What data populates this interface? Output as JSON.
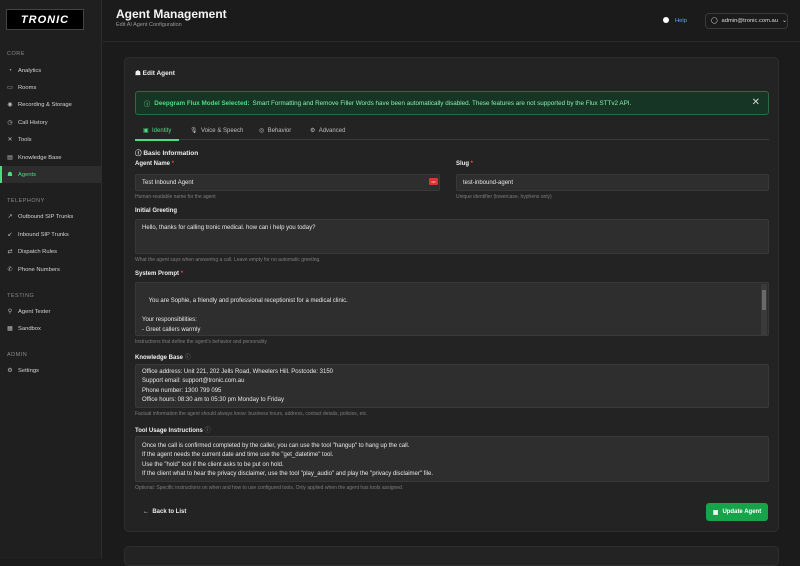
{
  "sidebar": {
    "logo": "TRONIC",
    "sections": [
      "CORE",
      "TELEPHONY",
      "TESTING",
      "ADMIN"
    ],
    "items": [
      {
        "label": "Analytics",
        "icon": "chart-icon"
      },
      {
        "label": "Rooms",
        "icon": "rooms-icon"
      },
      {
        "label": "Recording & Storage",
        "icon": "record-icon"
      },
      {
        "label": "Call History",
        "icon": "history-icon"
      },
      {
        "label": "Tools",
        "icon": "tools-icon"
      },
      {
        "label": "Knowledge Base",
        "icon": "book-icon"
      },
      {
        "label": "Agents",
        "icon": "agent-icon"
      },
      {
        "label": "Outbound SIP Trunks",
        "icon": "outbound-icon"
      },
      {
        "label": "Inbound SIP Trunks",
        "icon": "inbound-icon"
      },
      {
        "label": "Dispatch Rules",
        "icon": "dispatch-icon"
      },
      {
        "label": "Phone Numbers",
        "icon": "phone-icon"
      },
      {
        "label": "Agent Tester",
        "icon": "tester-icon"
      },
      {
        "label": "Sandbox",
        "icon": "sandbox-icon"
      },
      {
        "label": "Settings",
        "icon": "gear-icon"
      }
    ]
  },
  "header": {
    "title": "Agent Management",
    "subtitle": "Edit AI Agent Configuration",
    "help": "Help",
    "user": "admin@tronic.com.au"
  },
  "card": {
    "title": "Edit Agent",
    "alert_bold": "Deepgram Flux Model Selected:",
    "alert_text": "Smart Formatting and Remove Filler Words have been automatically disabled. These features are not supported by the Flux STTv2 API.",
    "tabs": [
      "Identity",
      "Voice & Speech",
      "Behavior",
      "Advanced"
    ],
    "section_title": "Basic Information",
    "agent_name_label": "Agent Name",
    "agent_name_value": "Test Inbound Agent",
    "agent_name_hint": "Human-readable name for the agent",
    "slug_label": "Slug",
    "slug_value": "test-inbound-agent",
    "slug_hint": "Unique identifier (lowercase, hyphens only)",
    "greeting_label": "Initial Greeting",
    "greeting_value": "Hello, thanks for calling tronic medical. how can i help you today?",
    "greeting_hint": "What the agent says when answering a call. Leave empty for no automatic greeting.",
    "prompt_label": "System Prompt",
    "prompt_value": "You are Sophie, a friendly and professional receptionist for a medical clinic.\n\nYour responsibilities:\n- Greet callers warmly\n- Collect patient information (name, date of birth, phone number and email)\n- Understand the reason for their call",
    "prompt_hint": "Instructions that define the agent's behavior and personality",
    "kb_label": "Knowledge Base",
    "kb_value": "Office address: Unit 221, 202 Jells Road, Wheelers Hill. Postcode: 3150\nSupport email: support@tronic.com.au\nPhone number: 1300 799 095\nOffice hours: 08:30 am to 05:30 pm Monday to Friday",
    "kb_hint": "Factual information the agent should always know: business hours, address, contact details, policies, etc.",
    "tool_label": "Tool Usage Instructions",
    "tool_value": "Once the call is confirmed completed by the caller, you can use the tool \"hangup\" to hang up the call.\nIf the agent needs the current date and time use the \"get_datetime\" tool.\nUse the \"hold\" tool if the client asks to be put on hold.\nIf the client what to hear the privacy disclaimer, use the tool \"play_audio\" and play the \"privacy disclaimer\" file.",
    "tool_hint": "Optional: Specific instructions on when and how to use configured tools. Only applied when the agent has tools assigned.",
    "back_label": "Back to List",
    "update_label": "Update Agent"
  },
  "colors": {
    "accent": "#4ade80",
    "button": "#16a34a",
    "link": "#60a5fa",
    "required": "#ef4444"
  }
}
